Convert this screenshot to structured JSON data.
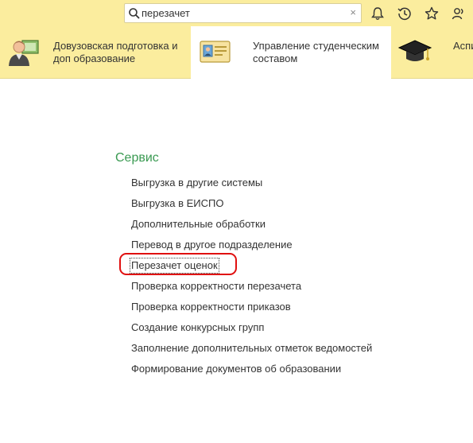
{
  "search": {
    "value": "перезачет",
    "icon": "search-icon",
    "clear_glyph": "×"
  },
  "toolbar_icons": [
    "bell-icon",
    "history-icon",
    "star-icon",
    "users-icon"
  ],
  "sections": [
    {
      "label_line1": "Довузовская подготовка и",
      "label_line2": "доп образование",
      "icon": "student-diploma-icon",
      "active": false
    },
    {
      "label_line1": "Управление студенческим",
      "label_line2": "составом",
      "icon": "student-card-icon",
      "active": true
    },
    {
      "label_line1": "Аспи",
      "label_line2": "",
      "icon": "graduation-cap-icon",
      "active": false
    }
  ],
  "group": {
    "title": "Сервис",
    "items": [
      "Выгрузка в другие системы",
      "Выгрузка в ЕИСПО",
      "Дополнительные обработки",
      "Перевод в другое подразделение",
      "Перезачет оценок",
      "Проверка корректности перезачета",
      "Проверка корректности приказов",
      "Создание конкурсных групп",
      "Заполнение дополнительных отметок ведомостей",
      "Формирование документов об образовании"
    ]
  },
  "colors": {
    "bar": "#fbed9e",
    "group_title": "#3a9a52",
    "highlight": "#e01010"
  }
}
